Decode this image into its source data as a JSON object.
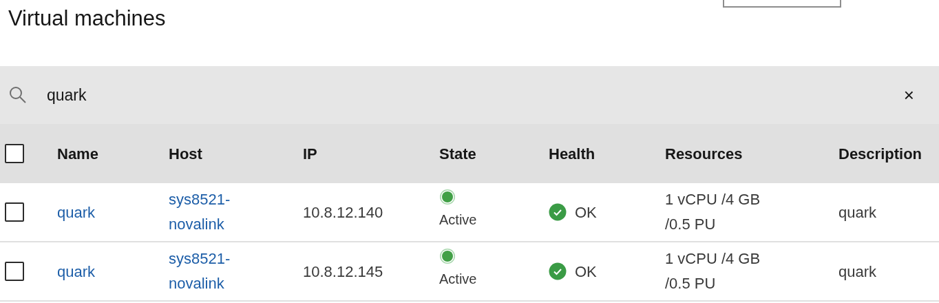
{
  "title": "Virtual machines",
  "search": {
    "value": "quark",
    "clear_label": "×"
  },
  "select_all": {
    "checked": false
  },
  "columns": [
    "Name",
    "Host",
    "IP",
    "State",
    "Health",
    "Resources",
    "Description"
  ],
  "rows": [
    {
      "selected": false,
      "name": "quark",
      "host": "sys8521-novalink",
      "ip": "10.8.12.140",
      "state": "Active",
      "health": "OK",
      "resources": "1 vCPU /4 GB /0.5 PU",
      "description": "quark"
    },
    {
      "selected": false,
      "name": "quark",
      "host": "sys8521-novalink",
      "ip": "10.8.12.145",
      "state": "Active",
      "health": "OK",
      "resources": "1 vCPU /4 GB /0.5 PU",
      "description": "quark"
    }
  ]
}
